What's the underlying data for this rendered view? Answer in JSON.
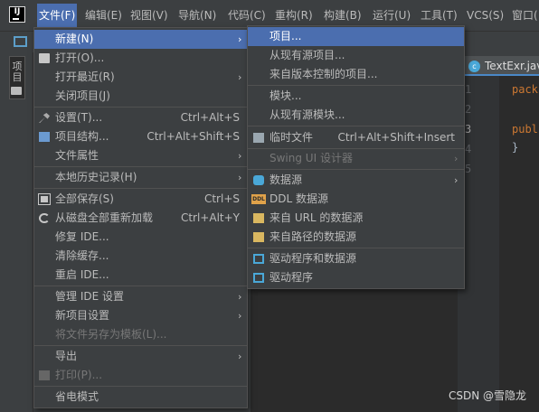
{
  "app": {
    "logo_text": "IJ"
  },
  "menubar": {
    "items": [
      {
        "label": "文件(F)",
        "active": true
      },
      {
        "label": "编辑(E)"
      },
      {
        "label": "视图(V)"
      },
      {
        "label": "导航(N)"
      },
      {
        "label": "代码(C)"
      },
      {
        "label": "重构(R)"
      },
      {
        "label": "构建(B)"
      },
      {
        "label": "运行(U)"
      },
      {
        "label": "工具(T)"
      },
      {
        "label": "VCS(S)"
      },
      {
        "label": "窗口("
      }
    ]
  },
  "left_strip": {
    "project_label": "项目"
  },
  "editor": {
    "tab_label": "TextExr.java",
    "tab_icon": "c",
    "line_numbers": [
      "1",
      "2",
      "3",
      "4",
      "5"
    ],
    "code_lines": [
      "pack",
      "publ",
      "}"
    ]
  },
  "file_menu": {
    "items": [
      {
        "label": "新建(N)",
        "shortcut": "",
        "submenu": true,
        "selected": true
      },
      {
        "label": "打开(O)...",
        "icon": "folder-icon"
      },
      {
        "label": "打开最近(R)",
        "submenu": true
      },
      {
        "label": "关闭项目(J)"
      },
      {
        "label": "设置(T)...",
        "shortcut": "Ctrl+Alt+S",
        "icon": "wrench-icon"
      },
      {
        "label": "项目结构...",
        "shortcut": "Ctrl+Alt+Shift+S",
        "icon": "project-structure-icon"
      },
      {
        "label": "文件属性",
        "submenu": true
      },
      {
        "label": "本地历史记录(H)",
        "submenu": true
      },
      {
        "label": "全部保存(S)",
        "shortcut": "Ctrl+S",
        "icon": "save-icon"
      },
      {
        "label": "从磁盘全部重新加载",
        "shortcut": "Ctrl+Alt+Y",
        "icon": "reload-icon"
      },
      {
        "label": "修复 IDE..."
      },
      {
        "label": "清除缓存..."
      },
      {
        "label": "重启 IDE..."
      },
      {
        "label": "管理 IDE 设置",
        "submenu": true
      },
      {
        "label": "新项目设置",
        "submenu": true
      },
      {
        "label": "将文件另存为模板(L)...",
        "disabled": true
      },
      {
        "label": "导出",
        "submenu": true
      },
      {
        "label": "打印(P)...",
        "disabled": true,
        "icon": "print-icon"
      },
      {
        "label": "省电模式"
      }
    ]
  },
  "new_submenu": {
    "items": [
      {
        "label": "项目...",
        "selected": true
      },
      {
        "label": "从现有源项目..."
      },
      {
        "label": "来自版本控制的项目..."
      },
      {
        "label": "模块..."
      },
      {
        "label": "从现有源模块..."
      },
      {
        "label": "临时文件",
        "shortcut": "Ctrl+Alt+Shift+Insert",
        "icon": "scratch-file-icon"
      },
      {
        "label": "Swing UI 设计器",
        "disabled": true,
        "submenu": true
      },
      {
        "label": "数据源",
        "submenu": true,
        "icon": "database-icon"
      },
      {
        "label": "DDL 数据源",
        "icon": "ddl-icon"
      },
      {
        "label": "来自 URL 的数据源",
        "icon": "url-datasource-icon"
      },
      {
        "label": "来自路径的数据源",
        "icon": "path-datasource-icon"
      },
      {
        "label": "驱动程序和数据源",
        "icon": "driver-icon"
      },
      {
        "label": "驱动程序",
        "icon": "driver-icon"
      }
    ]
  },
  "ddl_icon_text": "DDL",
  "submenu_arrow": "›",
  "watermark": "CSDN @雪隐龙"
}
